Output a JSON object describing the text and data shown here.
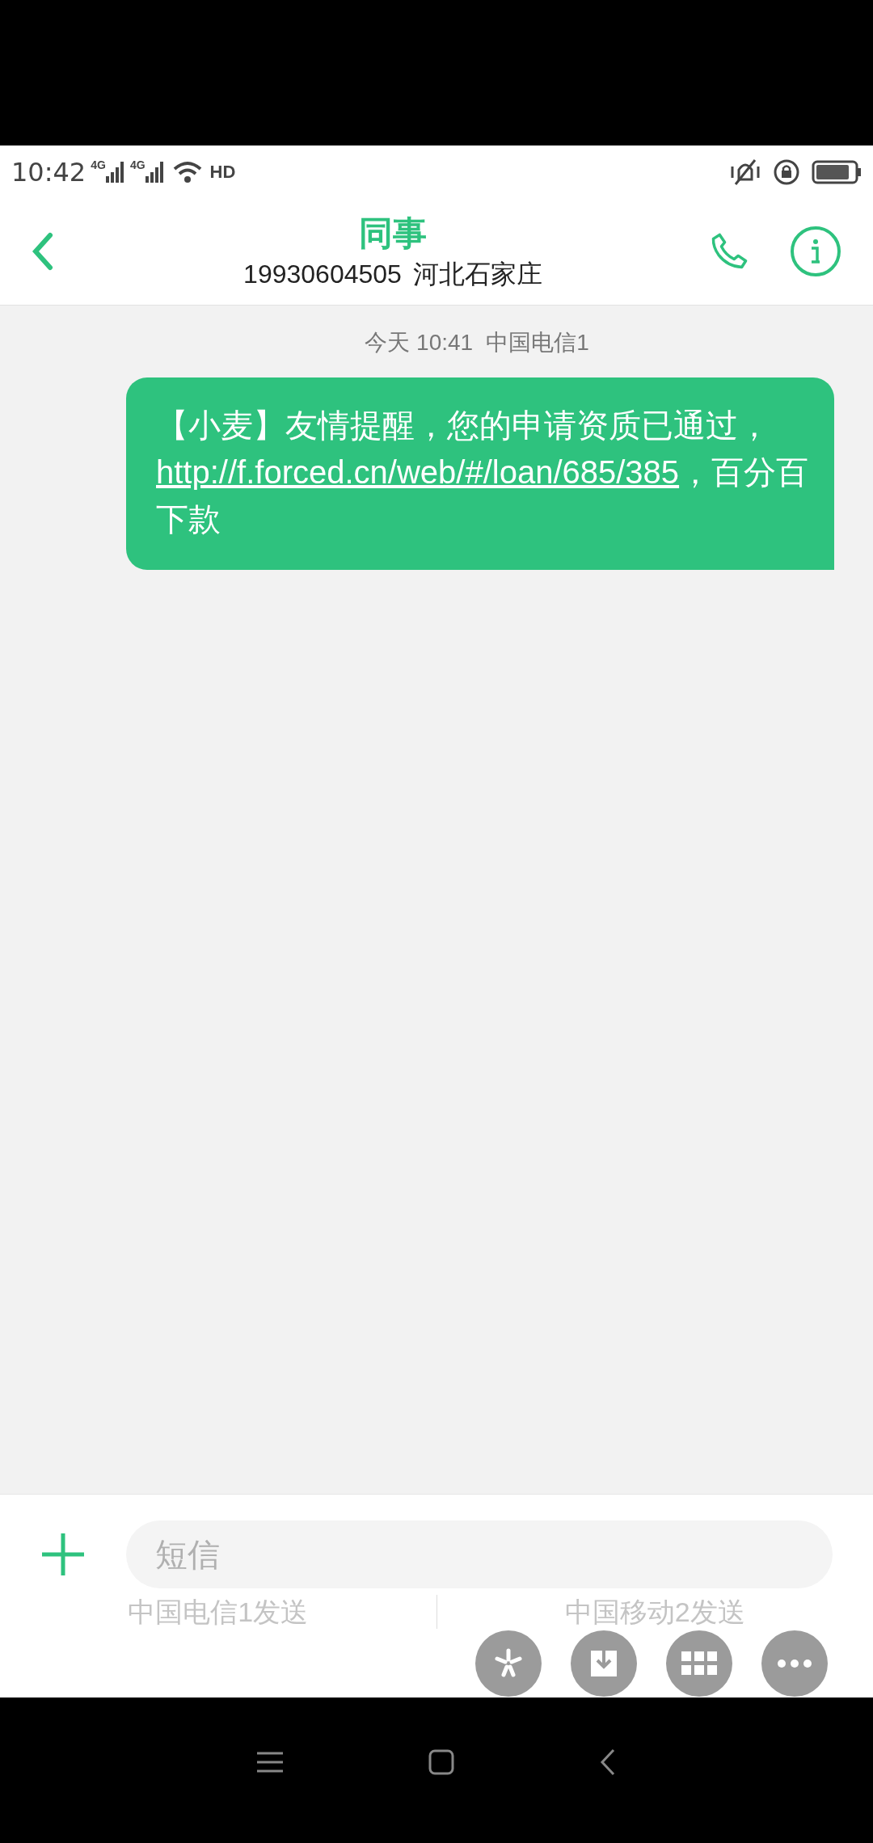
{
  "status_bar": {
    "time": "10:42",
    "signal_1": "4G",
    "signal_2": "4G",
    "hd": "HD"
  },
  "header": {
    "title": "同事",
    "number": "19930604505",
    "location": "河北石家庄"
  },
  "conversation": {
    "timestamp": "今天 10:41",
    "carrier": "中国电信1",
    "messages": [
      {
        "parts": [
          {
            "kind": "text",
            "text": "【小麦】友情提醒，您的申请资质已通过，"
          },
          {
            "kind": "link",
            "text": "http://f.forced.cn/web/#/loan/685/385"
          },
          {
            "kind": "text",
            "text": "，百分百下款"
          }
        ]
      }
    ]
  },
  "composer": {
    "placeholder": "短信",
    "send_options": [
      "中国电信1发送",
      "中国移动2发送"
    ]
  }
}
